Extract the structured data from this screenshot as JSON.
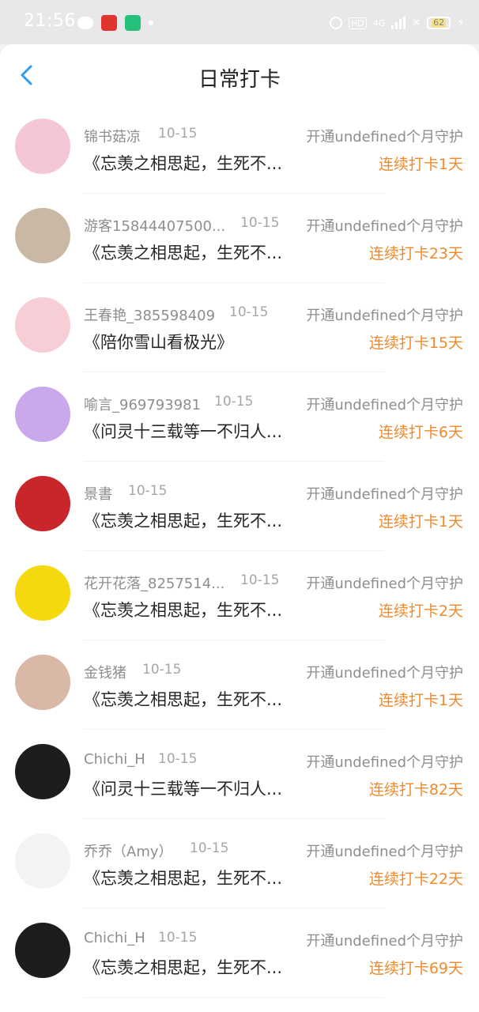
{
  "status_bar": {
    "time": "21:56",
    "battery": "62",
    "network": "4G"
  },
  "header": {
    "title": "日常打卡",
    "back_icon": "chevron-left-icon"
  },
  "colors": {
    "accent_blue": "#2b9cf2",
    "streak_orange": "#f08a2c",
    "meta_gray": "#8e8e8e"
  },
  "checkins": [
    {
      "name": "锦书菇凉",
      "date": "10-15",
      "plan": "开通undefined个月守护",
      "book": "《忘羡之相思起，生死不...",
      "streak": "连续打卡1天",
      "avatar_color": "#f5c6d6"
    },
    {
      "name": "游客15844407500...",
      "date": "10-15",
      "plan": "开通undefined个月守护",
      "book": "《忘羡之相思起，生死不...",
      "streak": "连续打卡23天",
      "avatar_color": "#c9b9a4"
    },
    {
      "name": "王春艳_385598409",
      "date": "10-15",
      "plan": "开通undefined个月守护",
      "book": "《陪你雪山看极光》",
      "streak": "连续打卡15天",
      "avatar_color": "#f7cdd6"
    },
    {
      "name": "喻言_969793981",
      "date": "10-15",
      "plan": "开通undefined个月守护",
      "book": "《问灵十三载等一不归人...",
      "streak": "连续打卡6天",
      "avatar_color": "#c9a9ea"
    },
    {
      "name": "景書",
      "date": "10-15",
      "plan": "开通undefined个月守护",
      "book": "《忘羡之相思起，生死不...",
      "streak": "连续打卡1天",
      "avatar_color": "#c8262a"
    },
    {
      "name": "花开花落_8257514...",
      "date": "10-15",
      "plan": "开通undefined个月守护",
      "book": "《忘羡之相思起，生死不...",
      "streak": "连续打卡2天",
      "avatar_color": "#f5d90f"
    },
    {
      "name": "金钱猪",
      "date": "10-15",
      "plan": "开通undefined个月守护",
      "book": "《忘羡之相思起，生死不...",
      "streak": "连续打卡1天",
      "avatar_color": "#d9b8a8"
    },
    {
      "name": "Chichi_H",
      "date": "10-15",
      "plan": "开通undefined个月守护",
      "book": "《问灵十三载等一不归人...",
      "streak": "连续打卡82天",
      "avatar_color": "#1d1d1d"
    },
    {
      "name": "乔乔（Amy）",
      "date": "10-15",
      "plan": "开通undefined个月守护",
      "book": "《忘羡之相思起，生死不...",
      "streak": "连续打卡22天",
      "avatar_color": "#f3f3f3"
    },
    {
      "name": "Chichi_H",
      "date": "10-15",
      "plan": "开通undefined个月守护",
      "book": "《忘羡之相思起，生死不...",
      "streak": "连续打卡69天",
      "avatar_color": "#1d1d1d"
    }
  ]
}
